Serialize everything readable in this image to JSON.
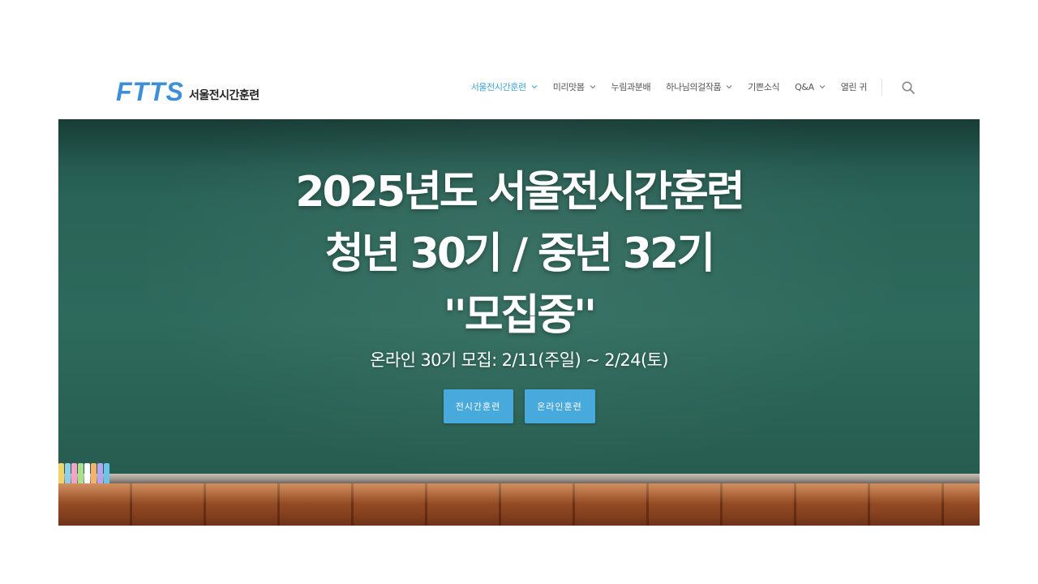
{
  "logo": {
    "mark": "FTTS",
    "text": "서울전시간훈련"
  },
  "nav": {
    "items": [
      {
        "label": "서울전시간훈련",
        "dropdown": true,
        "active": true
      },
      {
        "label": "미리맛봄",
        "dropdown": true,
        "active": false
      },
      {
        "label": "누림과분배",
        "dropdown": false,
        "active": false
      },
      {
        "label": "하나님의걸작품",
        "dropdown": true,
        "active": false
      },
      {
        "label": "기쁜소식",
        "dropdown": false,
        "active": false
      },
      {
        "label": "Q&A",
        "dropdown": true,
        "active": false
      },
      {
        "label": "열린 귀",
        "dropdown": false,
        "active": false
      }
    ],
    "search_icon": "search-icon"
  },
  "hero": {
    "title_line1": "2025년도 서울전시간훈련",
    "title_line2": "청년 30기 / 중년 32기",
    "title_line3": "''모집중''",
    "subtitle": "온라인 30기 모집: 2/11(주일) ~ 2/24(토)",
    "button_primary": "전시간훈련",
    "button_secondary": "온라인훈련"
  },
  "colors": {
    "accent": "#47a9dc",
    "nav_active": "#3fa4d9",
    "logo_blue": "#3f8fd8",
    "chalkboard": "#2d6a5c",
    "desk": "#9a4f25"
  }
}
